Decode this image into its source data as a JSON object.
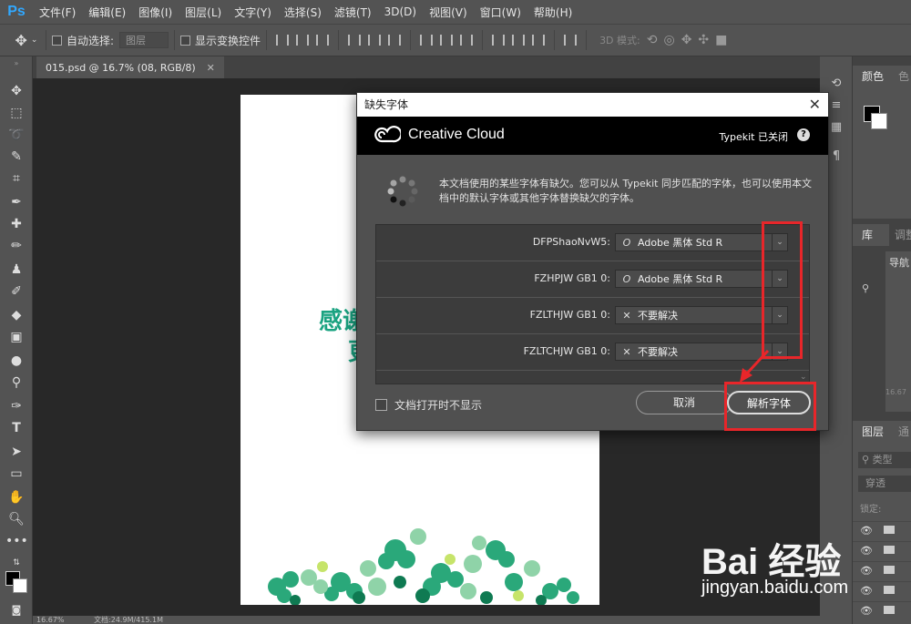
{
  "menubar": {
    "logo": "Ps",
    "items": [
      "文件(F)",
      "编辑(E)",
      "图像(I)",
      "图层(L)",
      "文字(Y)",
      "选择(S)",
      "滤镜(T)",
      "3D(D)",
      "视图(V)",
      "窗口(W)",
      "帮助(H)"
    ]
  },
  "options": {
    "auto_select": "自动选择:",
    "layer_select": "图层",
    "show_transform": "显示变换控件",
    "mode_3d": "3D 模式:"
  },
  "document": {
    "tab_title": "015.psd @ 16.7% (08, RGB/8)",
    "canvas_text_1": "感谢",
    "canvas_text_2": "更"
  },
  "status": {
    "zoom": "16.67%",
    "doc_info": "文档:24.9M/415.1M"
  },
  "panels": {
    "color_tab": "颜色",
    "swatch_tab": "色",
    "library_tab": "库",
    "adjust_tab": "调整",
    "navigator_tab": "导航",
    "nav_zoom": "16.67",
    "layers_tab": "图层",
    "channels_tab": "通",
    "kind_placeholder": "类型",
    "blend_mode": "穿透",
    "lock_label": "锁定:"
  },
  "dialog": {
    "title": "缺失字体",
    "brand": "Creative Cloud",
    "typekit_status": "Typekit 已关闭",
    "help": "?",
    "message": "本文档使用的某些字体有缺欠。您可以从 Typekit 同步匹配的字体，也可以使用本文档中的默认字体或其他字体替换缺欠的字体。",
    "fonts": [
      {
        "name": "DFPShaoNvW5:",
        "replacement": "Adobe 黑体 Std R",
        "icon": "O"
      },
      {
        "name": "FZHPJW  GB1 0:",
        "replacement": "Adobe 黑体 Std R",
        "icon": "O"
      },
      {
        "name": "FZLTHJW  GB1 0:",
        "replacement": "不要解决",
        "icon": "✕"
      },
      {
        "name": "FZLTCHJW  GB1 0:",
        "replacement": "不要解决",
        "icon": "✕"
      }
    ],
    "dont_show": "文档打开时不显示",
    "cancel": "取消",
    "resolve": "解析字体"
  },
  "watermark": {
    "brand": "Bai  经验",
    "url": "jingyan.baidu.com"
  },
  "colors": {
    "ui_bg": "#535353",
    "canvas_bg": "#282828",
    "accent_red": "#e8262a",
    "ps_blue": "#31a8ff",
    "green_text": "#1aa381"
  }
}
